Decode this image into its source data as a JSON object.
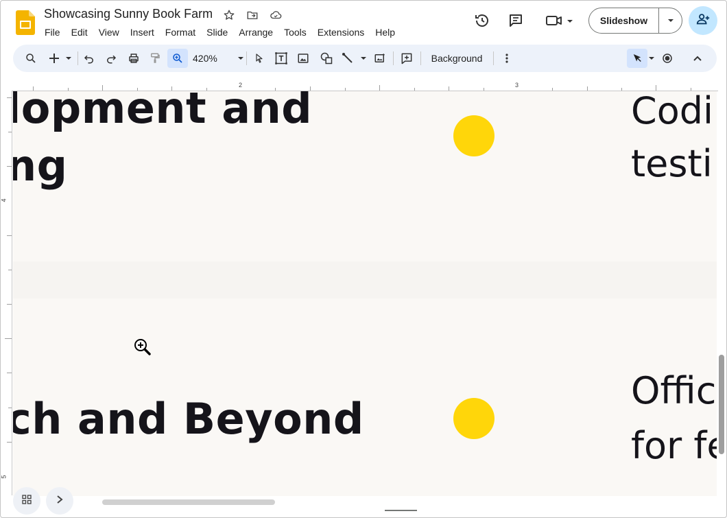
{
  "document": {
    "title": "Showcasing Sunny Book Farm"
  },
  "menu": [
    "File",
    "Edit",
    "View",
    "Insert",
    "Format",
    "Slide",
    "Arrange",
    "Tools",
    "Extensions",
    "Help"
  ],
  "header": {
    "slideshow_label": "Slideshow"
  },
  "toolbar": {
    "zoom_value": "420%",
    "background_label": "Background"
  },
  "ruler": {
    "h_labels": [
      "2",
      "3"
    ],
    "v_labels": [
      "4",
      "5"
    ]
  },
  "slide": {
    "heading_top_line1": "lopment and",
    "heading_top_line2": "ng",
    "heading_bottom": "ch and Beyond",
    "right_top_line1": "Codi",
    "right_top_line2": "testi",
    "right_bottom_line1": "Offic",
    "right_bottom_line2": "for fe"
  },
  "icons": [
    "app-logo",
    "star-icon",
    "move-to-folder-icon",
    "cloud-saved-icon",
    "history-icon",
    "comment-icon",
    "video-call-icon",
    "add-person-icon",
    "search-icon",
    "add-icon",
    "undo-icon",
    "redo-icon",
    "print-icon",
    "paint-format-icon",
    "zoom-icon",
    "select-icon",
    "text-box-icon",
    "image-icon",
    "shape-icon",
    "line-icon",
    "replace-image-icon",
    "new-comment-icon",
    "more-icon",
    "laser-pointer-icon",
    "record-icon",
    "collapse-icon",
    "grid-view-icon",
    "next-icon",
    "zoom-in-cursor"
  ],
  "colors": {
    "accent_dot": "#ffd60a",
    "canvas_bg": "#faf8f5",
    "toolbar_bg": "#edf2fa",
    "share_bg": "#c2e7ff",
    "logo": "#f4b400"
  }
}
